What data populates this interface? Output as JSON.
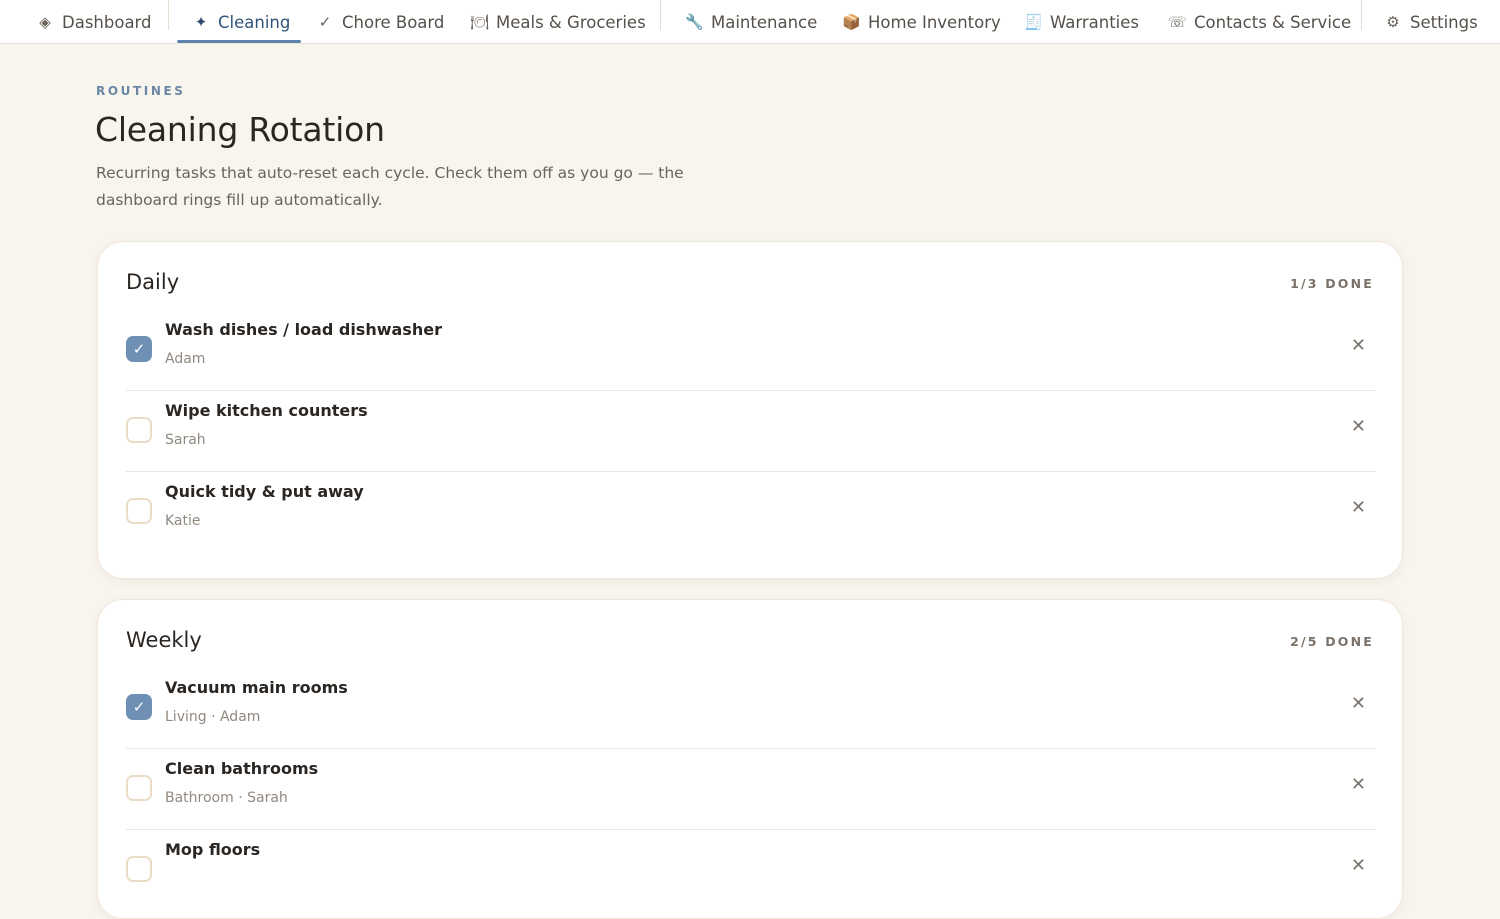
{
  "nav": {
    "items": [
      {
        "icon": "◈",
        "label": "Dashboard"
      },
      {
        "icon": "✦",
        "label": "Cleaning"
      },
      {
        "icon": "✓",
        "label": "Chore Board"
      },
      {
        "icon": "🍽",
        "label": "Meals & Groceries"
      },
      {
        "icon": "🔧",
        "label": "Maintenance"
      },
      {
        "icon": "📦",
        "label": "Home Inventory"
      },
      {
        "icon": "🧾",
        "label": "Warranties"
      },
      {
        "icon": "☏",
        "label": "Contacts & Service"
      },
      {
        "icon": "⚙",
        "label": "Settings"
      }
    ],
    "active": "Cleaning"
  },
  "header": {
    "eyebrow": "ROUTINES",
    "title": "Cleaning Rotation",
    "description": "Recurring tasks that auto-reset each cycle. Check them off as you go — the dashboard rings fill up automatically."
  },
  "sections": [
    {
      "title": "Daily",
      "count": "1/3 DONE",
      "tasks": [
        {
          "name": "Wash dishes / load dishwasher",
          "meta": "Adam",
          "done": true
        },
        {
          "name": "Wipe kitchen counters",
          "meta": "Sarah",
          "done": false
        },
        {
          "name": "Quick tidy & put away",
          "meta": "Katie",
          "done": false
        }
      ]
    },
    {
      "title": "Weekly",
      "count": "2/5 DONE",
      "tasks": [
        {
          "name": "Vacuum main rooms",
          "meta": "Living · Adam",
          "done": true
        },
        {
          "name": "Clean bathrooms",
          "meta": "Bathroom · Sarah",
          "done": false
        },
        {
          "name": "Mop floors",
          "meta": "",
          "done": false
        }
      ]
    }
  ],
  "icons": {
    "check": "✓",
    "remove": "✕"
  },
  "colors": {
    "accent": "#5d83ad",
    "checked": "#6f8fb4",
    "background": "#f8f4ee"
  }
}
